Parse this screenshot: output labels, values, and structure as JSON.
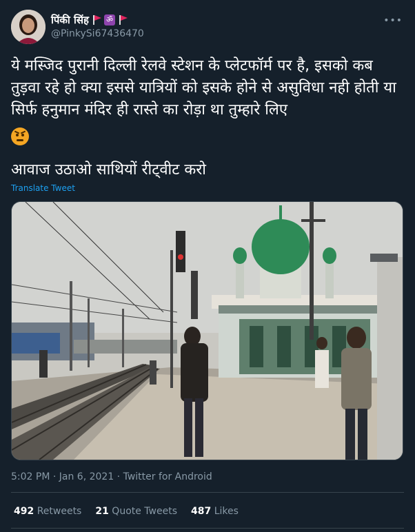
{
  "header": {
    "display_name": "पिंकी सिंह",
    "handle": "@PinkySi67436470",
    "more_icon": "more-dots-icon"
  },
  "tweet": {
    "text": "ये मस्जिद पुरानी दिल्ली रेलवे स्टेशन के प्लेटफॉर्म पर है, इसको कब तुड़वा रहे हो क्या इससे यात्रियों को इसके होने से असुविधा नही होती या सिर्फ हनुमान मंदिर ही रास्ते का रोड़ा था तुम्हारे लिए",
    "line2": "आवाज उठाओ साथियों रीट्वीट करो",
    "translate": "Translate Tweet",
    "emoji": "angry-face-icon"
  },
  "meta": {
    "time_date_source": "5:02 PM · Jan 6, 2021 · Twitter for Android"
  },
  "stats": {
    "retweets_count": "492",
    "retweets_label": "Retweets",
    "quotes_count": "21",
    "quotes_label": "Quote Tweets",
    "likes_count": "487",
    "likes_label": "Likes"
  },
  "colors": {
    "background": "#15202b",
    "accent": "#1da1f2",
    "muted": "#8899a6",
    "mosque_dome": "#2e8b57"
  }
}
